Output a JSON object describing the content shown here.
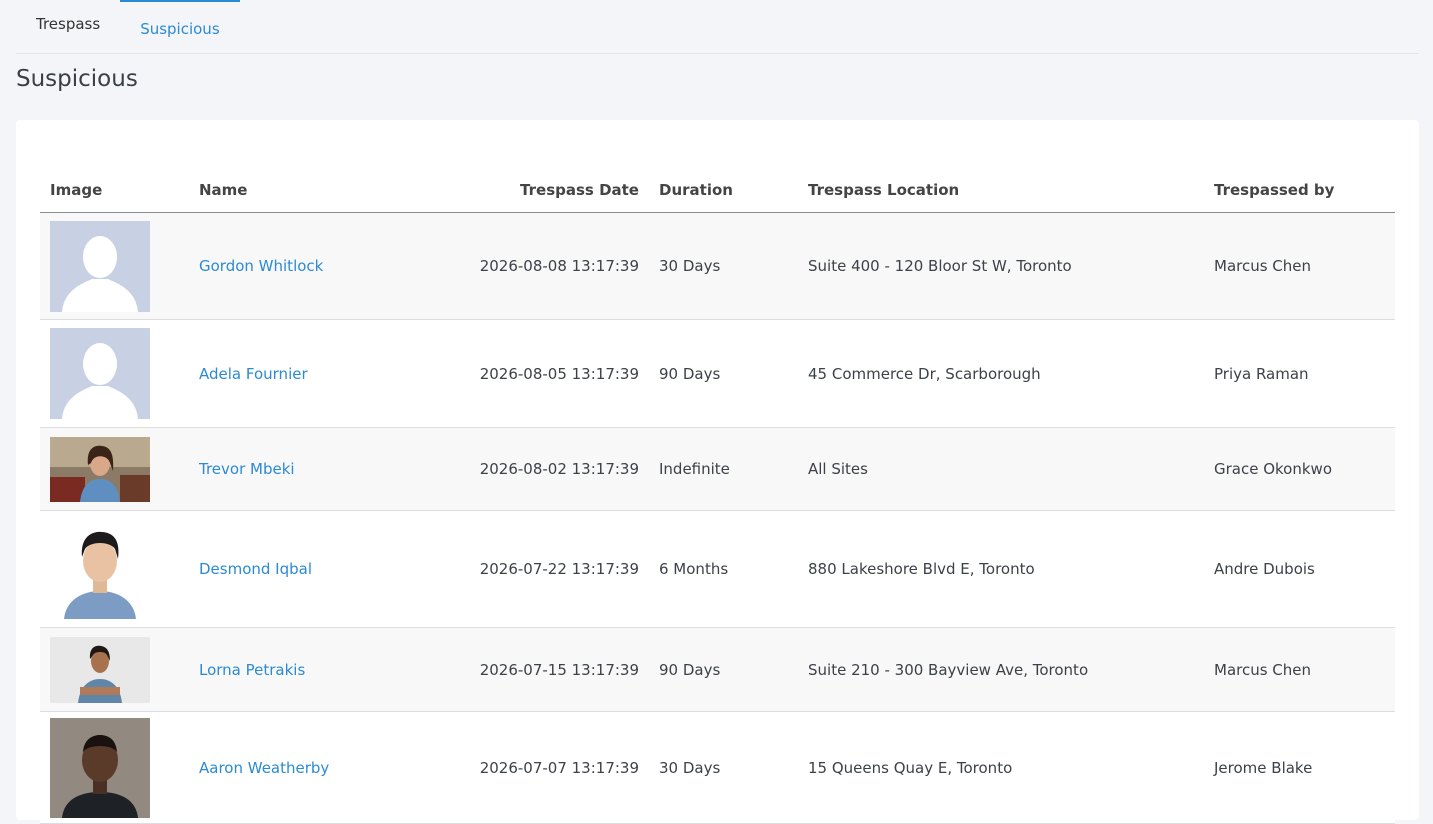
{
  "tabs": [
    {
      "label": "Trespass",
      "active": false
    },
    {
      "label": "Suspicious",
      "active": true
    }
  ],
  "page_title": "Suspicious",
  "accent_color": "#2b8ad4",
  "table": {
    "headers": {
      "image": "Image",
      "name": "Name",
      "date": "Trespass Date",
      "duration": "Duration",
      "location": "Trespass Location",
      "by": "Trespassed by"
    },
    "rows": [
      {
        "image": "placeholder-avatar-icon",
        "name": "Gordon Whitlock",
        "date": "2026-08-08 13:17:39",
        "duration": "30 Days",
        "location": "Suite 400 - 120 Bloor St W, Toronto",
        "by": "Marcus Chen"
      },
      {
        "image": "placeholder-avatar-icon",
        "name": "Adela Fournier",
        "date": "2026-08-05 13:17:39",
        "duration": "90 Days",
        "location": "45 Commerce Dr, Scarborough",
        "by": "Priya Raman"
      },
      {
        "image": "person-photo",
        "name": "Trevor Mbeki",
        "date": "2026-08-02 13:17:39",
        "duration": "Indefinite",
        "location": "All Sites",
        "by": "Grace Okonkwo"
      },
      {
        "image": "person-photo",
        "name": "Desmond Iqbal",
        "date": "2026-07-22 13:17:39",
        "duration": "6 Months",
        "location": "880 Lakeshore Blvd E, Toronto",
        "by": "Andre Dubois"
      },
      {
        "image": "person-photo",
        "name": "Lorna Petrakis",
        "date": "2026-07-15 13:17:39",
        "duration": "90 Days",
        "location": "Suite 210 - 300 Bayview Ave, Toronto",
        "by": "Marcus Chen"
      },
      {
        "image": "person-photo",
        "name": "Aaron Weatherby",
        "date": "2026-07-07 13:17:39",
        "duration": "30 Days",
        "location": "15 Queens Quay E, Toronto",
        "by": "Jerome Blake"
      }
    ]
  }
}
